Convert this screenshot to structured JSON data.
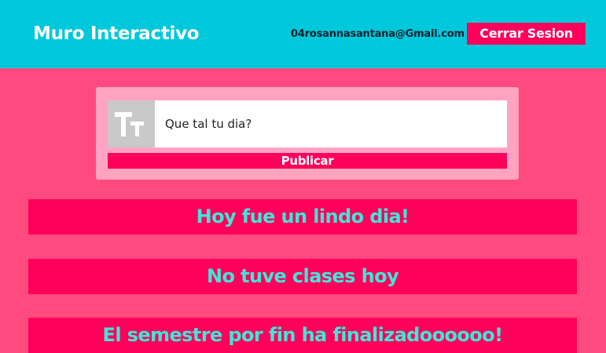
{
  "header": {
    "title": "Muro Interactivo",
    "user_email": "04rosannasantana@Gmail.com",
    "logout_label": "Cerrar Sesion"
  },
  "composer": {
    "icon": "text-size-icon",
    "input_placeholder": "Que tal tu dia?",
    "input_value": "",
    "publish_label": "Publicar"
  },
  "posts": [
    {
      "text": "Hoy fue un lindo dia!"
    },
    {
      "text": "No tuve clases hoy"
    },
    {
      "text": "El semestre por fin ha finalizadoooooo!"
    }
  ],
  "colors": {
    "header_bg": "#00c8db",
    "page_bg": "#ff4a7f",
    "accent": "#ff005a",
    "post_text": "#3ee7d9",
    "composer_bg": "#ffa3c0"
  }
}
